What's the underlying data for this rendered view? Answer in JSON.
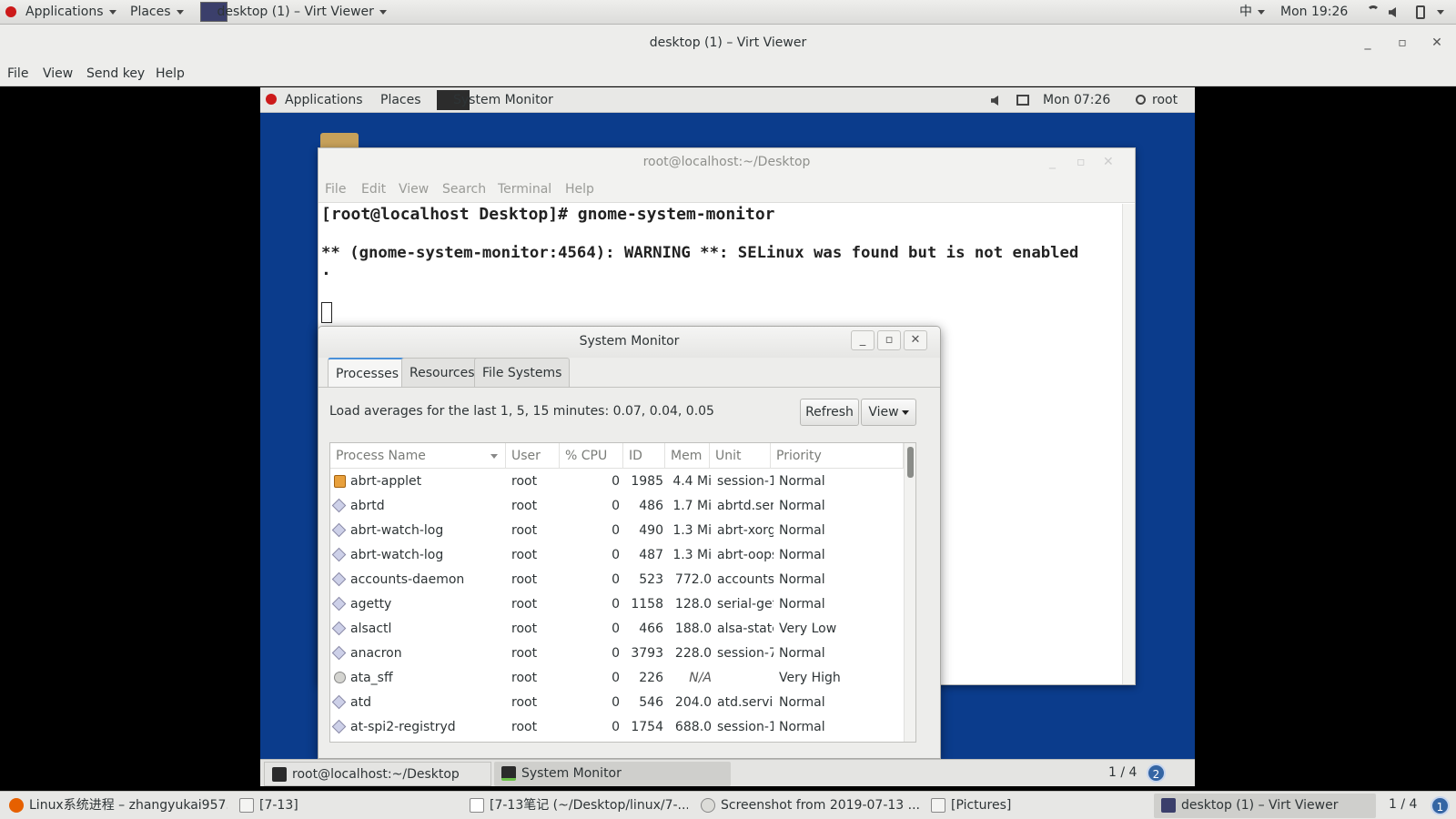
{
  "host_top": {
    "applications": "Applications",
    "places": "Places",
    "active_window": "desktop (1) – Virt Viewer",
    "input_method": "中",
    "clock": "Mon 19:26"
  },
  "viewer": {
    "title": "desktop (1) – Virt Viewer",
    "menu": [
      "File",
      "View",
      "Send key",
      "Help"
    ]
  },
  "guest_top": {
    "applications": "Applications",
    "places": "Places",
    "active_app": "System Monitor",
    "clock": "Mon 07:26",
    "user": "root"
  },
  "terminal": {
    "title": "root@localhost:~/Desktop",
    "menu": [
      "File",
      "Edit",
      "View",
      "Search",
      "Terminal",
      "Help"
    ],
    "line1": "[root@localhost Desktop]# gnome-system-monitor",
    "line2": "** (gnome-system-monitor:4564): WARNING **: SELinux was found but is not enabled",
    "line3": "."
  },
  "sysmon": {
    "title": "System Monitor",
    "tabs": [
      "Processes",
      "Resources",
      "File Systems"
    ],
    "load": "Load averages for the last 1, 5, 15 minutes: 0.07, 0.04, 0.05",
    "refresh": "Refresh",
    "view": "View",
    "columns": [
      "Process Name",
      "User",
      "% CPU",
      "ID",
      "Mem",
      "Unit",
      "Priority"
    ],
    "rows": [
      {
        "name": "abrt-applet",
        "user": "root",
        "cpu": "0",
        "id": "1985",
        "mem": "4.4 Mi",
        "unit": "session-1",
        "prio": "Normal",
        "icon": "applet"
      },
      {
        "name": "abrtd",
        "user": "root",
        "cpu": "0",
        "id": "486",
        "mem": "1.7 Mi",
        "unit": "abrtd.serv",
        "prio": "Normal",
        "icon": "proc"
      },
      {
        "name": "abrt-watch-log",
        "user": "root",
        "cpu": "0",
        "id": "490",
        "mem": "1.3 Mi",
        "unit": "abrt-xorg",
        "prio": "Normal",
        "icon": "proc"
      },
      {
        "name": "abrt-watch-log",
        "user": "root",
        "cpu": "0",
        "id": "487",
        "mem": "1.3 Mi",
        "unit": "abrt-oops",
        "prio": "Normal",
        "icon": "proc"
      },
      {
        "name": "accounts-daemon",
        "user": "root",
        "cpu": "0",
        "id": "523",
        "mem": "772.0",
        "unit": "accounts-",
        "prio": "Normal",
        "icon": "proc"
      },
      {
        "name": "agetty",
        "user": "root",
        "cpu": "0",
        "id": "1158",
        "mem": "128.0",
        "unit": "serial-get",
        "prio": "Normal",
        "icon": "proc"
      },
      {
        "name": "alsactl",
        "user": "root",
        "cpu": "0",
        "id": "466",
        "mem": "188.0",
        "unit": "alsa-state",
        "prio": "Very Low",
        "icon": "proc"
      },
      {
        "name": "anacron",
        "user": "root",
        "cpu": "0",
        "id": "3793",
        "mem": "228.0",
        "unit": "session-7",
        "prio": "Normal",
        "icon": "proc"
      },
      {
        "name": "ata_sff",
        "user": "root",
        "cpu": "0",
        "id": "226",
        "mem": "N/A",
        "unit": "",
        "prio": "Very High",
        "icon": "gear"
      },
      {
        "name": "atd",
        "user": "root",
        "cpu": "0",
        "id": "546",
        "mem": "204.0",
        "unit": "atd.servic",
        "prio": "Normal",
        "icon": "proc"
      },
      {
        "name": "at-spi2-registryd",
        "user": "root",
        "cpu": "0",
        "id": "1754",
        "mem": "688.0",
        "unit": "session-1",
        "prio": "Normal",
        "icon": "proc"
      }
    ]
  },
  "guest_bottom": {
    "tasks": [
      "root@localhost:~/Desktop",
      "System Monitor"
    ],
    "workspace": "1 / 4",
    "notif": "2"
  },
  "host_bottom": {
    "tasks": [
      "Linux系统进程 – zhangyukai957...",
      "[7-13]",
      "[7-13笔记 (~/Desktop/linux/7-...",
      "Screenshot from 2019-07-13 ...",
      "[Pictures]",
      "desktop (1) – Virt Viewer"
    ],
    "workspace": "1 / 4",
    "notif": "1"
  }
}
